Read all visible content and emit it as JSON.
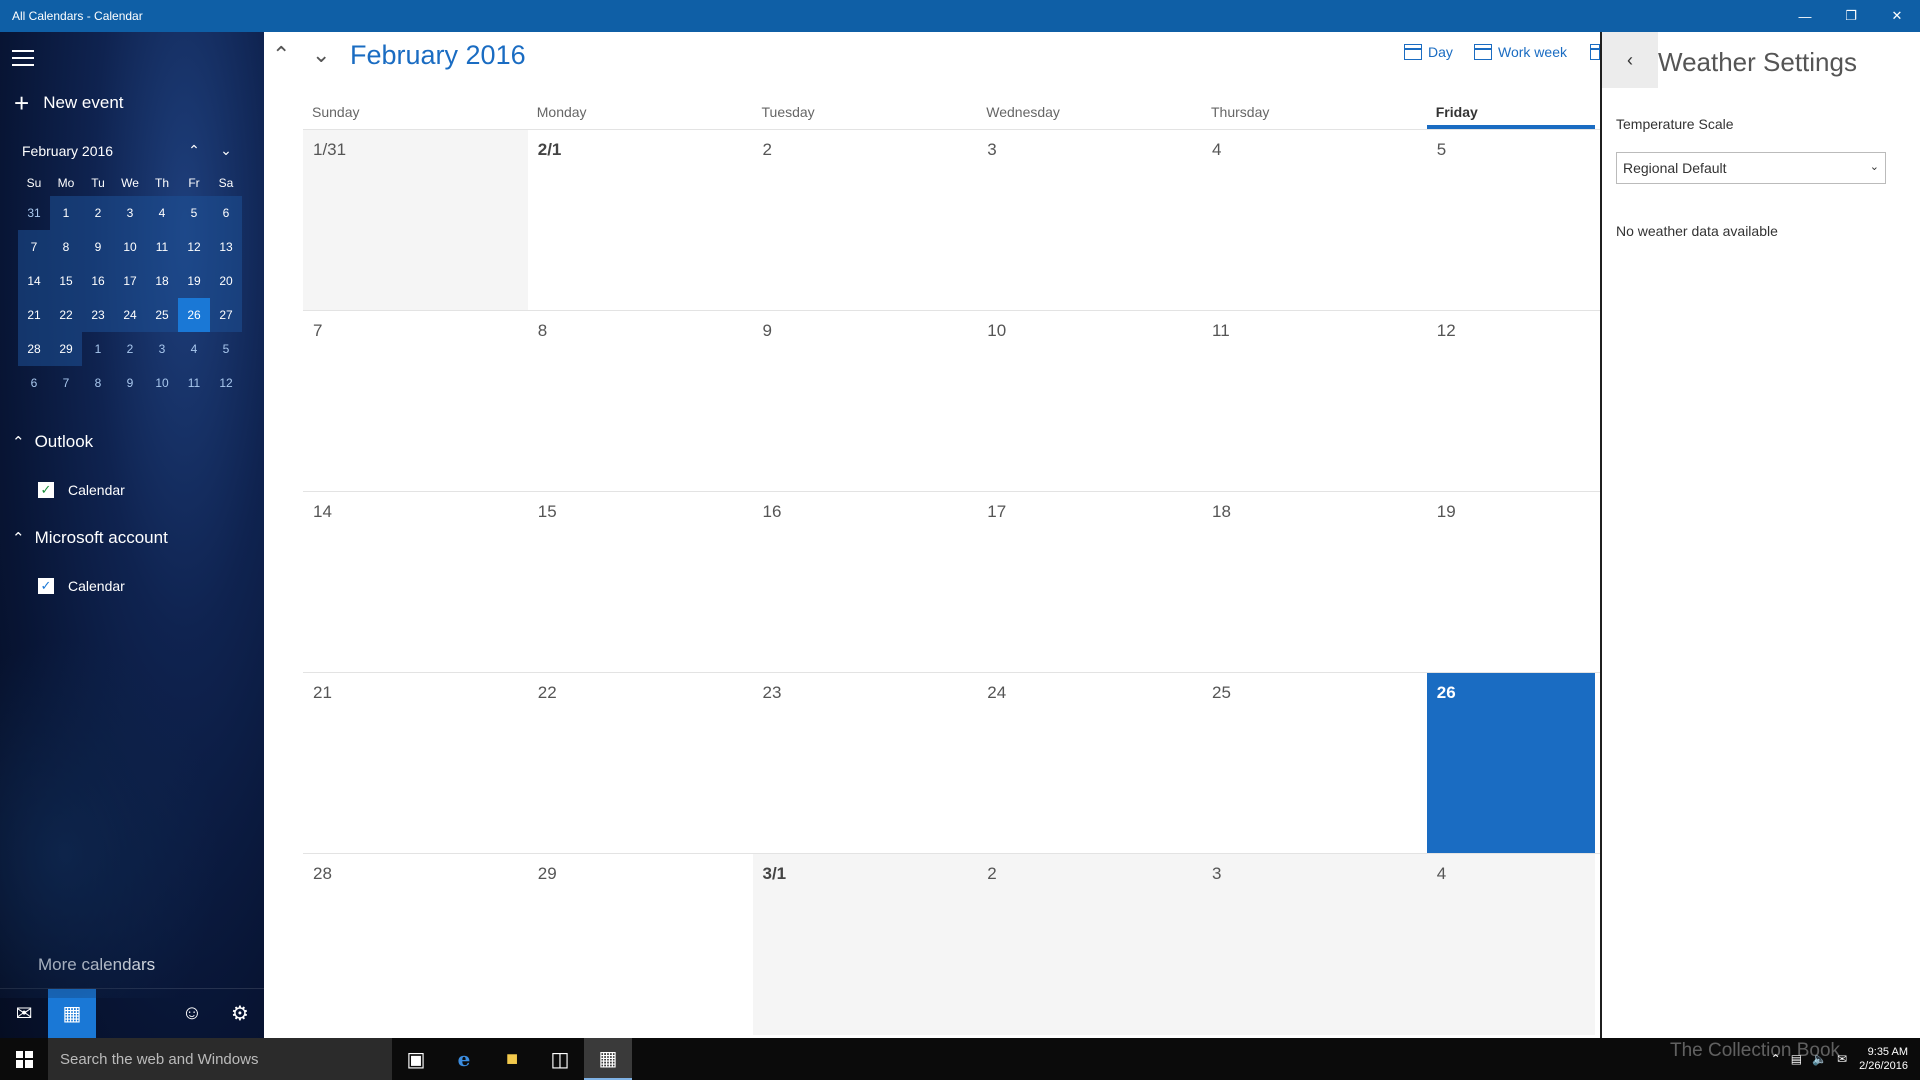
{
  "window": {
    "title": "All Calendars - Calendar"
  },
  "sidebar": {
    "new_event": "New event",
    "mini_calendar": {
      "month_title": "February 2016",
      "weekdays": [
        "Su",
        "Mo",
        "Tu",
        "We",
        "Th",
        "Fr",
        "Sa"
      ],
      "weeks": [
        [
          "31",
          "1",
          "2",
          "3",
          "4",
          "5",
          "6"
        ],
        [
          "7",
          "8",
          "9",
          "10",
          "11",
          "12",
          "13"
        ],
        [
          "14",
          "15",
          "16",
          "17",
          "18",
          "19",
          "20"
        ],
        [
          "21",
          "22",
          "23",
          "24",
          "25",
          "26",
          "27"
        ],
        [
          "28",
          "29",
          "1",
          "2",
          "3",
          "4",
          "5"
        ],
        [
          "6",
          "7",
          "8",
          "9",
          "10",
          "11",
          "12"
        ]
      ]
    },
    "groups": [
      {
        "name": "Outlook",
        "calendar": "Calendar"
      },
      {
        "name": "Microsoft account",
        "calendar": "Calendar"
      }
    ],
    "more_calendars": "More calendars"
  },
  "main": {
    "month_title": "February 2016",
    "views": {
      "day": "Day",
      "work_week": "Work week"
    },
    "day_names": [
      "Sunday",
      "Monday",
      "Tuesday",
      "Wednesday",
      "Thursday",
      "Friday"
    ],
    "weeks": [
      [
        "1/31",
        "2/1",
        "2",
        "3",
        "4",
        "5"
      ],
      [
        "7",
        "8",
        "9",
        "10",
        "11",
        "12"
      ],
      [
        "14",
        "15",
        "16",
        "17",
        "18",
        "19"
      ],
      [
        "21",
        "22",
        "23",
        "24",
        "25",
        "26"
      ],
      [
        "28",
        "29",
        "3/1",
        "2",
        "3",
        "4"
      ]
    ]
  },
  "weather_pane": {
    "title": "Weather Settings",
    "temperature_label": "Temperature Scale",
    "temperature_value": "Regional Default",
    "message": "No weather data available"
  },
  "taskbar": {
    "search_placeholder": "Search the web and Windows",
    "watermark": "The Collection Book",
    "time": "9:35 AM",
    "date": "2/26/2016"
  },
  "colors": {
    "accent": "#1a6cc2",
    "titlebar": "#0f5fa6",
    "today": "#1a78d6"
  }
}
